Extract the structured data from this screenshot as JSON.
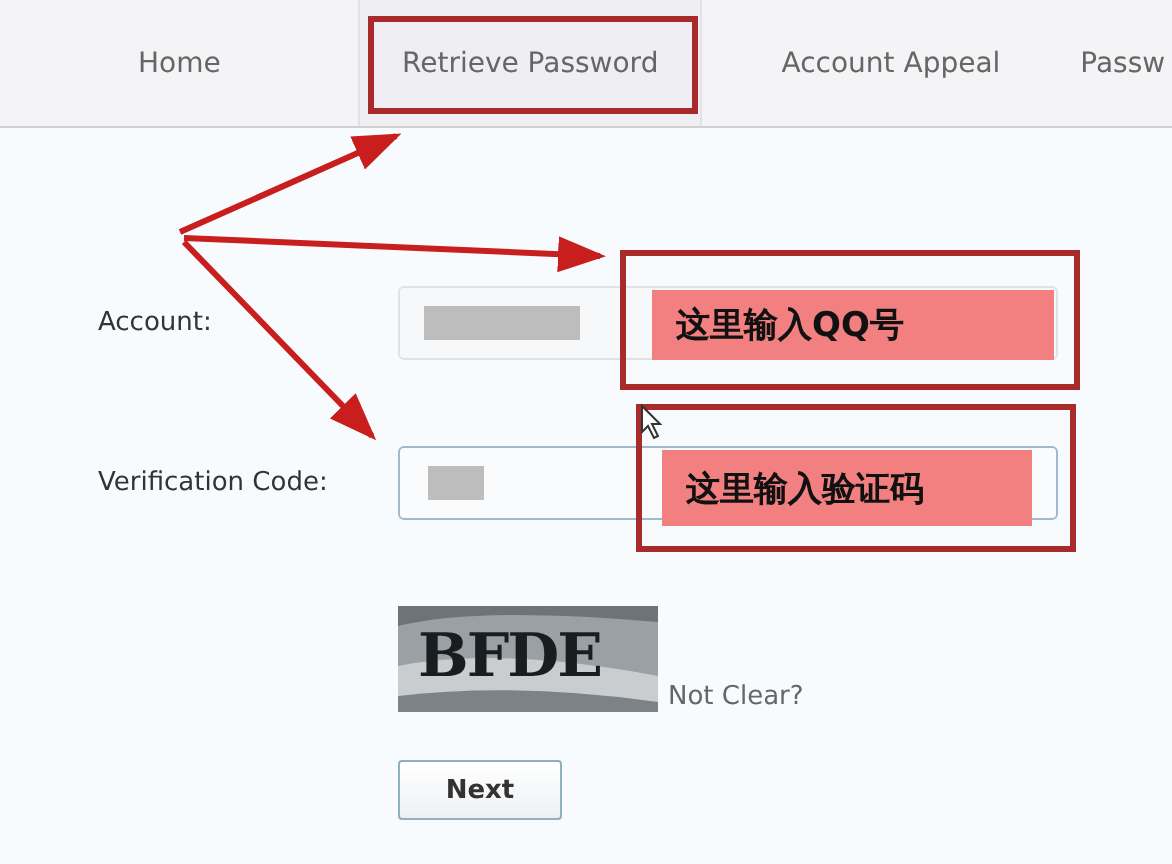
{
  "tabs": [
    {
      "label": "Home",
      "selected": false
    },
    {
      "label": "Retrieve Password",
      "selected": true
    },
    {
      "label": "Account Appeal",
      "selected": false
    },
    {
      "label": "Passw",
      "selected": false
    }
  ],
  "fields": [
    {
      "label": "Account:",
      "focused": false
    },
    {
      "label": "Verification Code:",
      "focused": true
    }
  ],
  "captcha": {
    "text": "BFDE",
    "link": "Not Clear?"
  },
  "next_button": "Next",
  "callouts": [
    "这里输入QQ号",
    "这里输入验证码"
  ]
}
